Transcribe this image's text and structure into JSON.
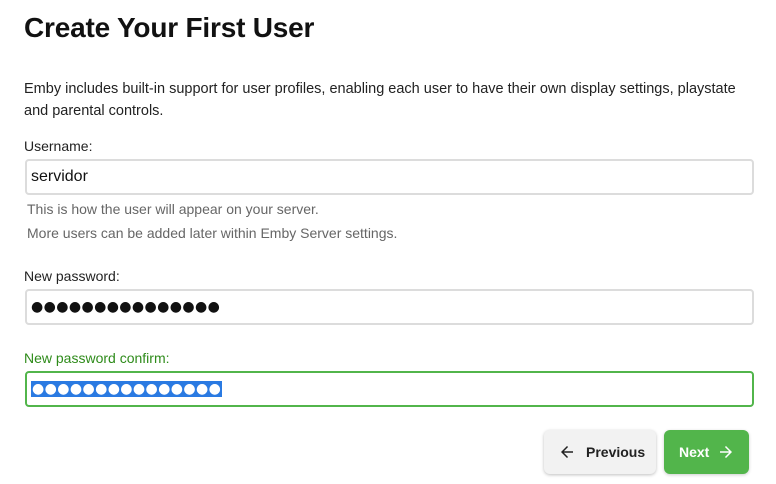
{
  "page": {
    "title": "Create Your First User",
    "intro": "Emby includes built-in support for user profiles, enabling each user to have their own display settings, playstate and parental controls."
  },
  "form": {
    "username": {
      "label": "Username:",
      "value": "servidor",
      "help_1": "This is how the user will appear on your server.",
      "help_2": "More users can be added later within Emby Server settings."
    },
    "password": {
      "label": "New password:",
      "masked_value": "●●●●●●●●●●●●●●●"
    },
    "password_confirm": {
      "label": "New password confirm:",
      "masked_value": "●●●●●●●●●●●●●●●"
    }
  },
  "buttons": {
    "previous_label": "Previous",
    "next_label": "Next",
    "previous_icon": "arrow-left-icon",
    "next_icon": "arrow-right-icon"
  },
  "colors": {
    "accent": "#52b54b",
    "focused_label": "#2e8b1a",
    "selection": "#2a7ae2"
  }
}
